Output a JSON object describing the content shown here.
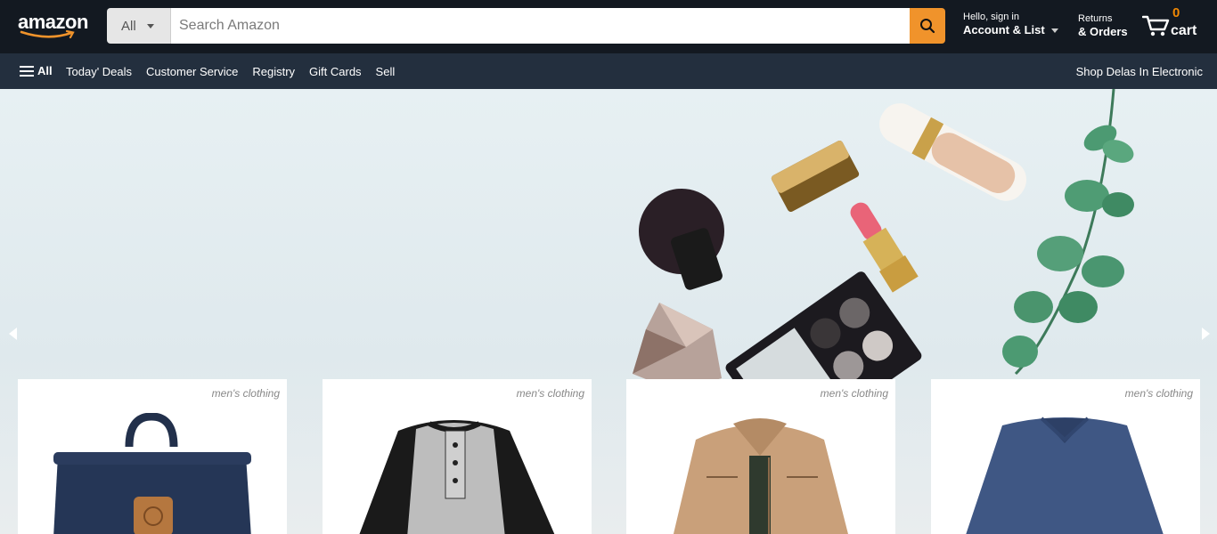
{
  "header": {
    "logo_text": "amazon",
    "search": {
      "category": "All",
      "placeholder": "Search Amazon",
      "button_icon": "search-icon"
    },
    "account": {
      "line1": "Hello, sign in",
      "line2": "Account & List"
    },
    "returns": {
      "line1": "Returns",
      "line2": "& Orders"
    },
    "cart": {
      "count": "0",
      "label": "cart",
      "icon": "cart-icon"
    }
  },
  "subnav": {
    "all_label": "All",
    "links": [
      "Today' Deals",
      "Customer Service",
      "Registry",
      "Gift Cards",
      "Sell"
    ],
    "promo": "Shop Delas In Electronic"
  },
  "hero": {
    "left_arrow_icon": "chevron-left-icon",
    "right_arrow_icon": "chevron-right-icon"
  },
  "products": [
    {
      "category": "men's clothing",
      "image": "backpack"
    },
    {
      "category": "men's clothing",
      "image": "henley-shirt"
    },
    {
      "category": "men's clothing",
      "image": "jacket"
    },
    {
      "category": "men's clothing",
      "image": "long-sleeve-tee"
    }
  ],
  "colors": {
    "header_bg": "#131921",
    "subnav_bg": "#232f3e",
    "accent": "#f0932b",
    "cart_count": "#f08804"
  }
}
